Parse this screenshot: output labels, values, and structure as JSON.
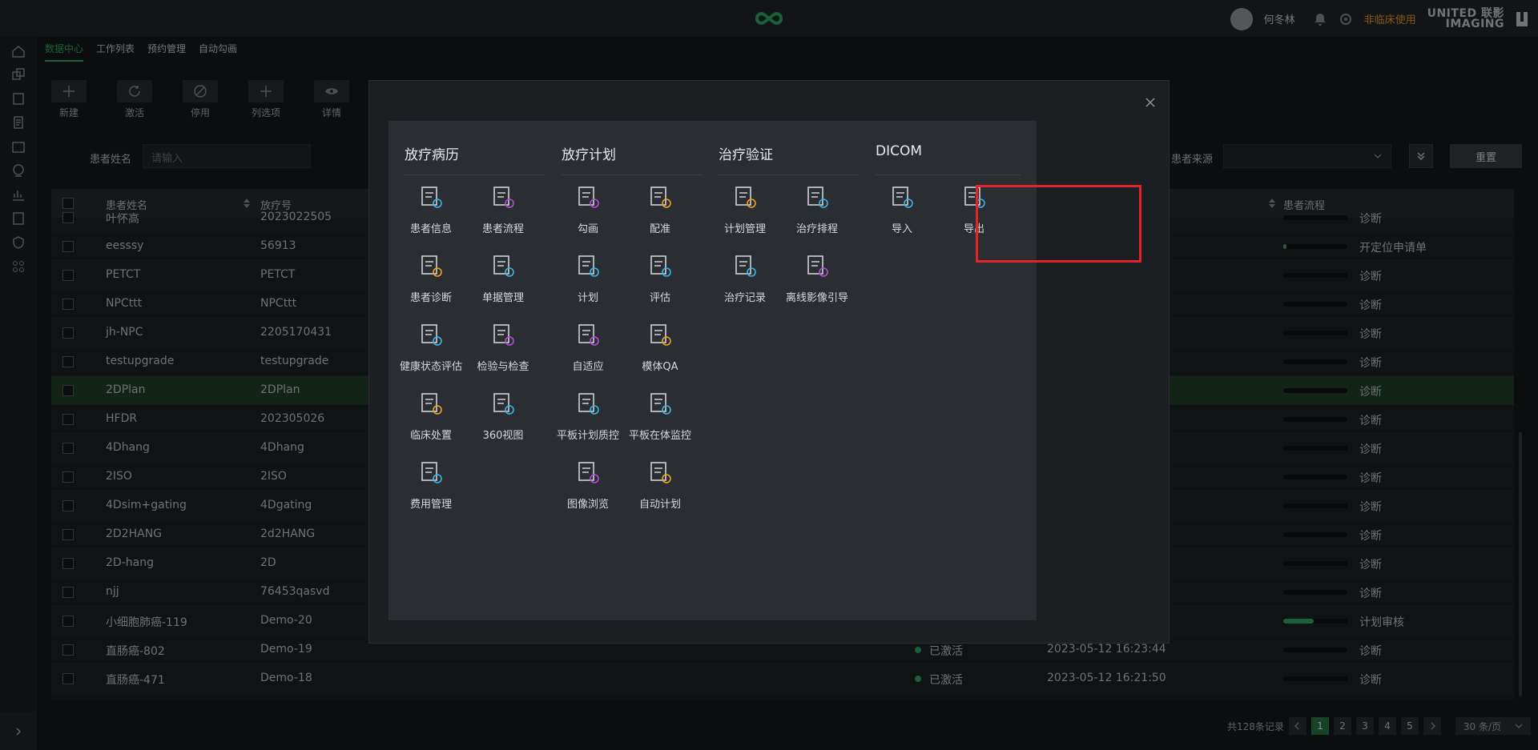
{
  "header": {
    "user_name": "何冬林",
    "non_clinical": "非临床使用",
    "brand_line1": "UNITED 联影",
    "brand_line2": "IMAGING"
  },
  "tabs": [
    "数据中心",
    "工作列表",
    "预约管理",
    "自动勾画"
  ],
  "toolbar": [
    {
      "label": "新建",
      "icon": "plus-icon"
    },
    {
      "label": "激活",
      "icon": "refresh-icon"
    },
    {
      "label": "停用",
      "icon": "ban-icon"
    },
    {
      "label": "列选项",
      "icon": "plus-icon"
    },
    {
      "label": "详情",
      "icon": "eye-icon"
    }
  ],
  "filters": {
    "name_label": "患者姓名",
    "name_placeholder": "请输入",
    "source_label": "患者来源",
    "reset": "重置"
  },
  "table": {
    "headers": {
      "name": "患者姓名",
      "radio_no": "放疗号",
      "flow": "患者流程"
    },
    "rows": [
      {
        "name": "叶怀高",
        "no": "2023022505",
        "status": "",
        "time": "",
        "progress": 0,
        "flow": "诊断"
      },
      {
        "name": "eesssy",
        "no": "56913",
        "status": "",
        "time": "",
        "progress": 5,
        "flow": "开定位申请单"
      },
      {
        "name": "PETCT",
        "no": "PETCT",
        "status": "",
        "time": "",
        "progress": 0,
        "flow": "诊断"
      },
      {
        "name": "NPCttt",
        "no": "NPCttt",
        "status": "",
        "time": "",
        "progress": 0,
        "flow": "诊断"
      },
      {
        "name": "jh-NPC",
        "no": "2205170431",
        "status": "",
        "time": "",
        "progress": 0,
        "flow": "诊断"
      },
      {
        "name": "testupgrade",
        "no": "testupgrade",
        "status": "",
        "time": "",
        "progress": 0,
        "flow": "诊断"
      },
      {
        "name": "2DPlan",
        "no": "2DPlan",
        "status": "",
        "time": "",
        "progress": 0,
        "flow": "诊断",
        "selected": true
      },
      {
        "name": "HFDR",
        "no": "202305026",
        "status": "",
        "time": "",
        "progress": 0,
        "flow": "诊断"
      },
      {
        "name": "4Dhang",
        "no": "4Dhang",
        "status": "",
        "time": "",
        "progress": 0,
        "flow": "诊断"
      },
      {
        "name": "2ISO",
        "no": "2ISO",
        "status": "",
        "time": "",
        "progress": 0,
        "flow": "诊断"
      },
      {
        "name": "4Dsim+gating",
        "no": "4Dgating",
        "status": "",
        "time": "",
        "progress": 0,
        "flow": "诊断"
      },
      {
        "name": "2D2HANG",
        "no": "2d2HANG",
        "status": "",
        "time": "",
        "progress": 0,
        "flow": "诊断"
      },
      {
        "name": "2D-hang",
        "no": "2D",
        "status": "",
        "time": "",
        "progress": 0,
        "flow": "诊断"
      },
      {
        "name": "njj",
        "no": "76453qasvd",
        "status": "",
        "time": "",
        "progress": 0,
        "flow": "诊断"
      },
      {
        "name": "小细胞肺癌-119",
        "no": "Demo-20",
        "status": "",
        "time": "",
        "progress": 48,
        "flow": "计划审核"
      },
      {
        "name": "直肠癌-802",
        "no": "Demo-19",
        "status": "已激活",
        "time": "2023-05-12 16:23:44",
        "progress": 0,
        "flow": "诊断"
      },
      {
        "name": "直肠癌-471",
        "no": "Demo-18",
        "status": "已激活",
        "time": "2023-05-12 16:21:50",
        "progress": 0,
        "flow": "诊断"
      }
    ]
  },
  "pager": {
    "total": "共128条记录",
    "pages": [
      "1",
      "2",
      "3",
      "4",
      "5"
    ],
    "size": "30 条/页"
  },
  "modal": {
    "cards": [
      {
        "title": "放疗病历",
        "items": [
          "患者信息",
          "患者流程",
          "患者诊断",
          "单据管理",
          "健康状态评估",
          "检验与检查",
          "临床处置",
          "360视图",
          "费用管理"
        ]
      },
      {
        "title": "放疗计划",
        "items": [
          "勾画",
          "配准",
          "计划",
          "评估",
          "自适应",
          "模体QA",
          "平板计划质控",
          "平板在体监控",
          "图像浏览",
          "自动计划"
        ]
      },
      {
        "title": "治疗验证",
        "items": [
          "计划管理",
          "治疗排程",
          "治疗记录",
          "离线影像引导"
        ]
      },
      {
        "title": "DICOM",
        "items": [
          "导入",
          "导出"
        ]
      }
    ]
  },
  "colors": {
    "accent": "#2fb369",
    "highlight": "#e2232a",
    "warning": "#f0a020"
  }
}
